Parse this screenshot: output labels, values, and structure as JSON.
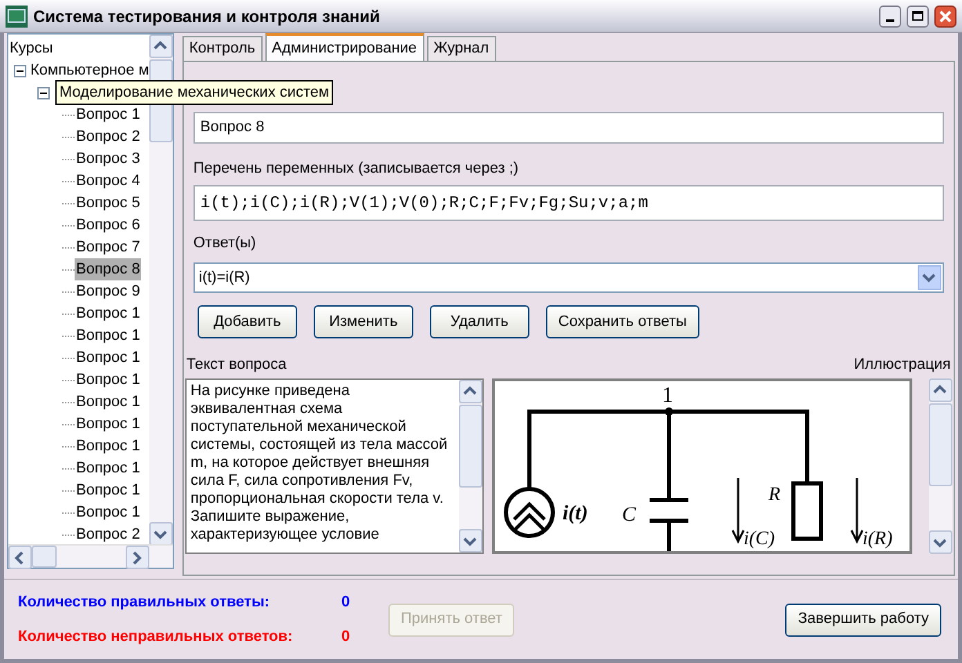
{
  "window": {
    "title": "Система тестирования и контроля знаний"
  },
  "tree": {
    "header": "Курсы",
    "root": {
      "label": "Компьютерное м",
      "expanded": true,
      "children": [
        {
          "label": "Моделирование механических систем",
          "expanded": true,
          "children": [
            {
              "label": "Вопрос 1",
              "selected": false
            },
            {
              "label": "Вопрос 2",
              "selected": false
            },
            {
              "label": "Вопрос 3",
              "selected": false
            },
            {
              "label": "Вопрос 4",
              "selected": false
            },
            {
              "label": "Вопрос 5",
              "selected": false
            },
            {
              "label": "Вопрос 6",
              "selected": false
            },
            {
              "label": "Вопрос 7",
              "selected": false
            },
            {
              "label": "Вопрос 8",
              "selected": true
            },
            {
              "label": "Вопрос 9",
              "selected": false
            },
            {
              "label": "Вопрос 1",
              "selected": false
            },
            {
              "label": "Вопрос 1",
              "selected": false
            },
            {
              "label": "Вопрос 1",
              "selected": false
            },
            {
              "label": "Вопрос 1",
              "selected": false
            },
            {
              "label": "Вопрос 1",
              "selected": false
            },
            {
              "label": "Вопрос 1",
              "selected": false
            },
            {
              "label": "Вопрос 1",
              "selected": false
            },
            {
              "label": "Вопрос 1",
              "selected": false
            },
            {
              "label": "Вопрос 1",
              "selected": false
            },
            {
              "label": "Вопрос 1",
              "selected": false
            },
            {
              "label": "Вопрос 2",
              "selected": false
            }
          ]
        }
      ]
    }
  },
  "tabs": [
    {
      "label": "Контроль",
      "selected": false
    },
    {
      "label": "Администрирование",
      "selected": true
    },
    {
      "label": "Журнал",
      "selected": false
    }
  ],
  "question_name": {
    "value": "Вопрос 8"
  },
  "variables": {
    "label": "Перечень переменных (записывается через ;)",
    "value": "i(t);i(C);i(R);V(1);V(0);R;C;F;Fv;Fg;Su;v;a;m"
  },
  "answers": {
    "label": "Ответ(ы)",
    "value": "i(t)=i(R)"
  },
  "buttons": [
    "Добавить",
    "Изменить",
    "Удалить",
    "Сохранить ответы"
  ],
  "question_text": {
    "label": "Текст вопроса",
    "value": "На рисунке приведена эквивалентная схема поступательной механической системы, состоящей из тела массой m, на которое действует внешняя сила F, сила сопротивления Fv, пропорциональная скорости тела v. Запишите выражение, характеризующее условие"
  },
  "illustration": {
    "label": "Иллюстрация",
    "node": "1",
    "source": "i(t)",
    "capacitor": "C",
    "capacitor_current": "i(C)",
    "resistor": "R",
    "resistor_current": "i(R)"
  },
  "stats": [
    {
      "label": "Количество правильных ответы:",
      "value": "0",
      "color": "#0000ff"
    },
    {
      "label": "Количество неправильных ответов:",
      "value": "0",
      "color": "#ff0000"
    }
  ],
  "accept_button": {
    "label": "Принять ответ",
    "disabled": true
  },
  "finish_button": {
    "label": "Завершить работу"
  }
}
